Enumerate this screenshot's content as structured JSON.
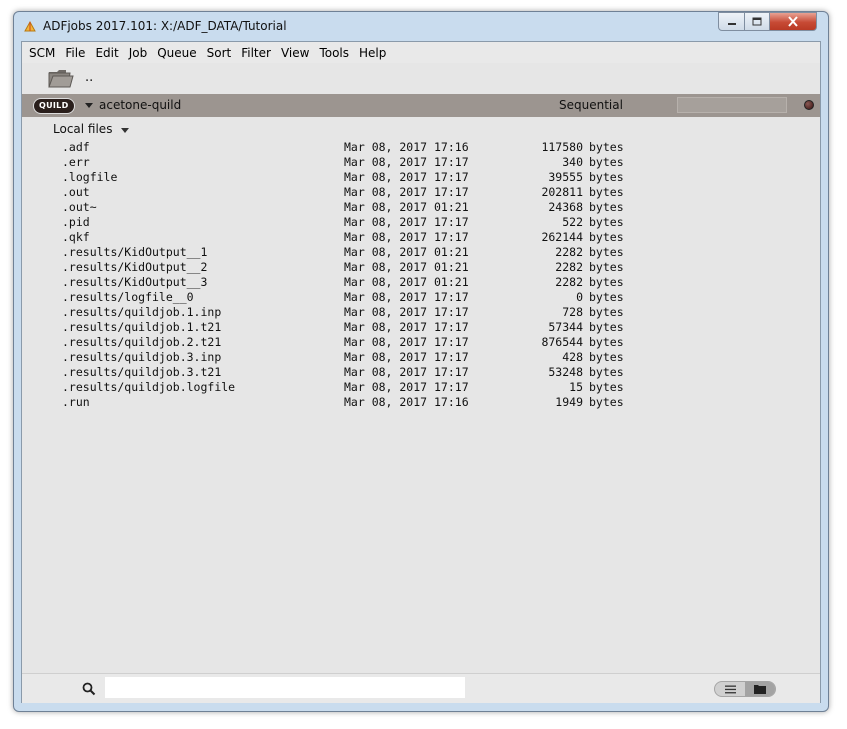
{
  "window": {
    "title": "ADFjobs 2017.101: X:/ADF_DATA/Tutorial"
  },
  "menu": [
    "SCM",
    "File",
    "Edit",
    "Job",
    "Queue",
    "Sort",
    "Filter",
    "View",
    "Tools",
    "Help"
  ],
  "toolbar": {
    "parent_dir": ".."
  },
  "job": {
    "badge": "QUILD",
    "name": "acetone-quild",
    "queue": "Sequential",
    "status_color": "#3a1210"
  },
  "files_section": {
    "label": "Local files"
  },
  "files": [
    {
      "name": ".adf",
      "date": "Mar 08, 2017 17:16",
      "size": "117580",
      "unit": "bytes"
    },
    {
      "name": ".err",
      "date": "Mar 08, 2017 17:17",
      "size": "340",
      "unit": "bytes"
    },
    {
      "name": ".logfile",
      "date": "Mar 08, 2017 17:17",
      "size": "39555",
      "unit": "bytes"
    },
    {
      "name": ".out",
      "date": "Mar 08, 2017 17:17",
      "size": "202811",
      "unit": "bytes"
    },
    {
      "name": ".out~",
      "date": "Mar 08, 2017 01:21",
      "size": "24368",
      "unit": "bytes"
    },
    {
      "name": ".pid",
      "date": "Mar 08, 2017 17:17",
      "size": "522",
      "unit": "bytes"
    },
    {
      "name": ".qkf",
      "date": "Mar 08, 2017 17:17",
      "size": "262144",
      "unit": "bytes"
    },
    {
      "name": ".results/KidOutput__1",
      "date": "Mar 08, 2017 01:21",
      "size": "2282",
      "unit": "bytes"
    },
    {
      "name": ".results/KidOutput__2",
      "date": "Mar 08, 2017 01:21",
      "size": "2282",
      "unit": "bytes"
    },
    {
      "name": ".results/KidOutput__3",
      "date": "Mar 08, 2017 01:21",
      "size": "2282",
      "unit": "bytes"
    },
    {
      "name": ".results/logfile__0",
      "date": "Mar 08, 2017 17:17",
      "size": "0",
      "unit": "bytes"
    },
    {
      "name": ".results/quildjob.1.inp",
      "date": "Mar 08, 2017 17:17",
      "size": "728",
      "unit": "bytes"
    },
    {
      "name": ".results/quildjob.1.t21",
      "date": "Mar 08, 2017 17:17",
      "size": "57344",
      "unit": "bytes"
    },
    {
      "name": ".results/quildjob.2.t21",
      "date": "Mar 08, 2017 17:17",
      "size": "876544",
      "unit": "bytes"
    },
    {
      "name": ".results/quildjob.3.inp",
      "date": "Mar 08, 2017 17:17",
      "size": "428",
      "unit": "bytes"
    },
    {
      "name": ".results/quildjob.3.t21",
      "date": "Mar 08, 2017 17:17",
      "size": "53248",
      "unit": "bytes"
    },
    {
      "name": ".results/quildjob.logfile",
      "date": "Mar 08, 2017 17:17",
      "size": "15",
      "unit": "bytes"
    },
    {
      "name": ".run",
      "date": "Mar 08, 2017 17:16",
      "size": "1949",
      "unit": "bytes"
    }
  ],
  "search": {
    "value": "",
    "placeholder": ""
  },
  "icons": {
    "app": "adfjobs-app-icon",
    "folder": "folder-icon",
    "search": "search-icon",
    "list_view": "list-view-icon",
    "folder_view": "folder-view-icon"
  }
}
